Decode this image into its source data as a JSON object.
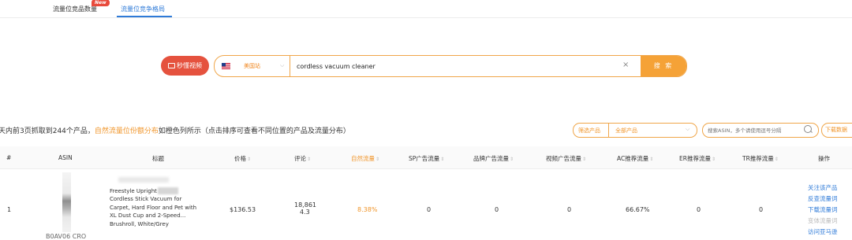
{
  "tabs": [
    {
      "label": "流量位竞品数量",
      "badge": "New"
    },
    {
      "label": "流量位竞争格局"
    }
  ],
  "search": {
    "video_button": "秒懂视频",
    "country": "美国站",
    "query": "cordless vacuum cleaner",
    "button": "搜 索"
  },
  "summary": {
    "prefix": "天内前3页抓取到244个产品，",
    "highlight": "自然流量位份额分布",
    "suffix": "如橙色列所示（点击排序可查看不同位置的产品及流量分布）"
  },
  "filter": {
    "label": "筛选产品",
    "value": "全部产品"
  },
  "asin_search": {
    "placeholder": "搜索ASIN，多个请使用逗号分隔"
  },
  "download_label": "下载数据",
  "table": {
    "headers": [
      "#",
      "ASIN",
      "标题",
      "价格",
      "评论",
      "自然流量",
      "SP广告流量",
      "品牌广告流量",
      "视频广告流量",
      "AC推荐流量",
      "ER推荐流量",
      "TR推荐流量",
      "操作"
    ],
    "rows": [
      {
        "index": "1",
        "asin": "B0AV06 CRO",
        "title_lines": [
          "Freestyle Upright Pass",
          "Cordless Stick Vacuum for",
          "Carpet, Hard Floor and Pet with",
          "XL Dust Cup and 2-Speed...",
          "Brushroll, White/Grey"
        ],
        "price": "$136.53",
        "reviews": "18,861",
        "rating": "4.3",
        "organic": "8.38%",
        "sp": "0",
        "brand": "0",
        "video": "0",
        "ac": "66.67%",
        "er": "0",
        "tr": "0",
        "actions": [
          "关注该产品",
          "反查流量词",
          "下载流量词",
          "变体流量词",
          "访问亚马逊"
        ]
      }
    ]
  },
  "colors": {
    "accent": "#f5a237",
    "link": "#2f7bd8",
    "video_button": "#e5523e"
  }
}
